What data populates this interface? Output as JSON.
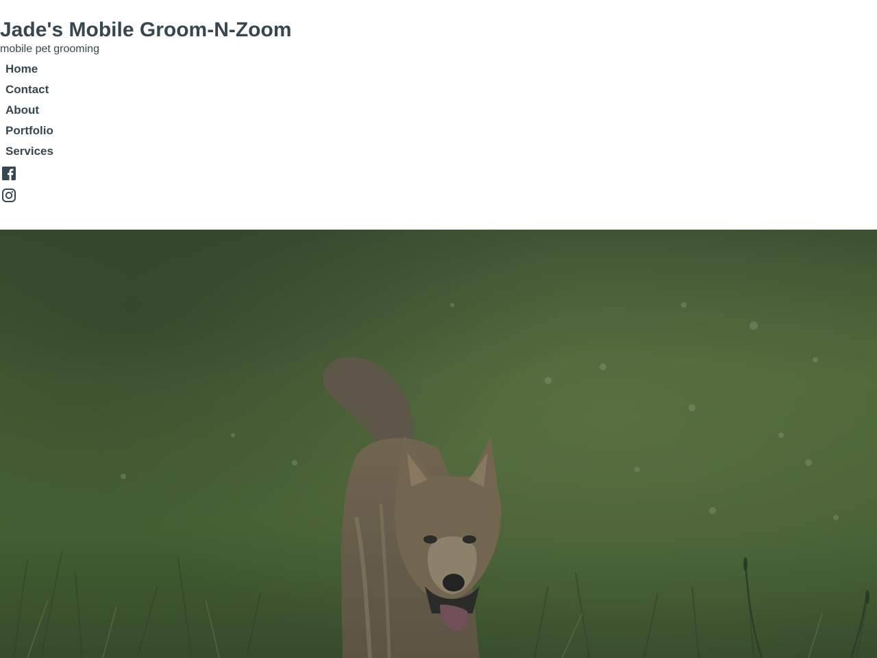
{
  "site": {
    "title": "Jade's Mobile Groom-N-Zoom",
    "tagline": "mobile pet grooming"
  },
  "nav": {
    "items": [
      {
        "label": "Home"
      },
      {
        "label": "Contact"
      },
      {
        "label": "About"
      },
      {
        "label": "Portfolio"
      },
      {
        "label": "Services"
      }
    ]
  },
  "social": {
    "icons": [
      "facebook-icon",
      "instagram-icon"
    ]
  },
  "hero": {
    "image": "puppy-in-grass-photo"
  },
  "colors": {
    "text": "#37474f",
    "background": "#ffffff",
    "hero_grass": "#4f6a30",
    "hero_overlay": "#2f3d46"
  }
}
